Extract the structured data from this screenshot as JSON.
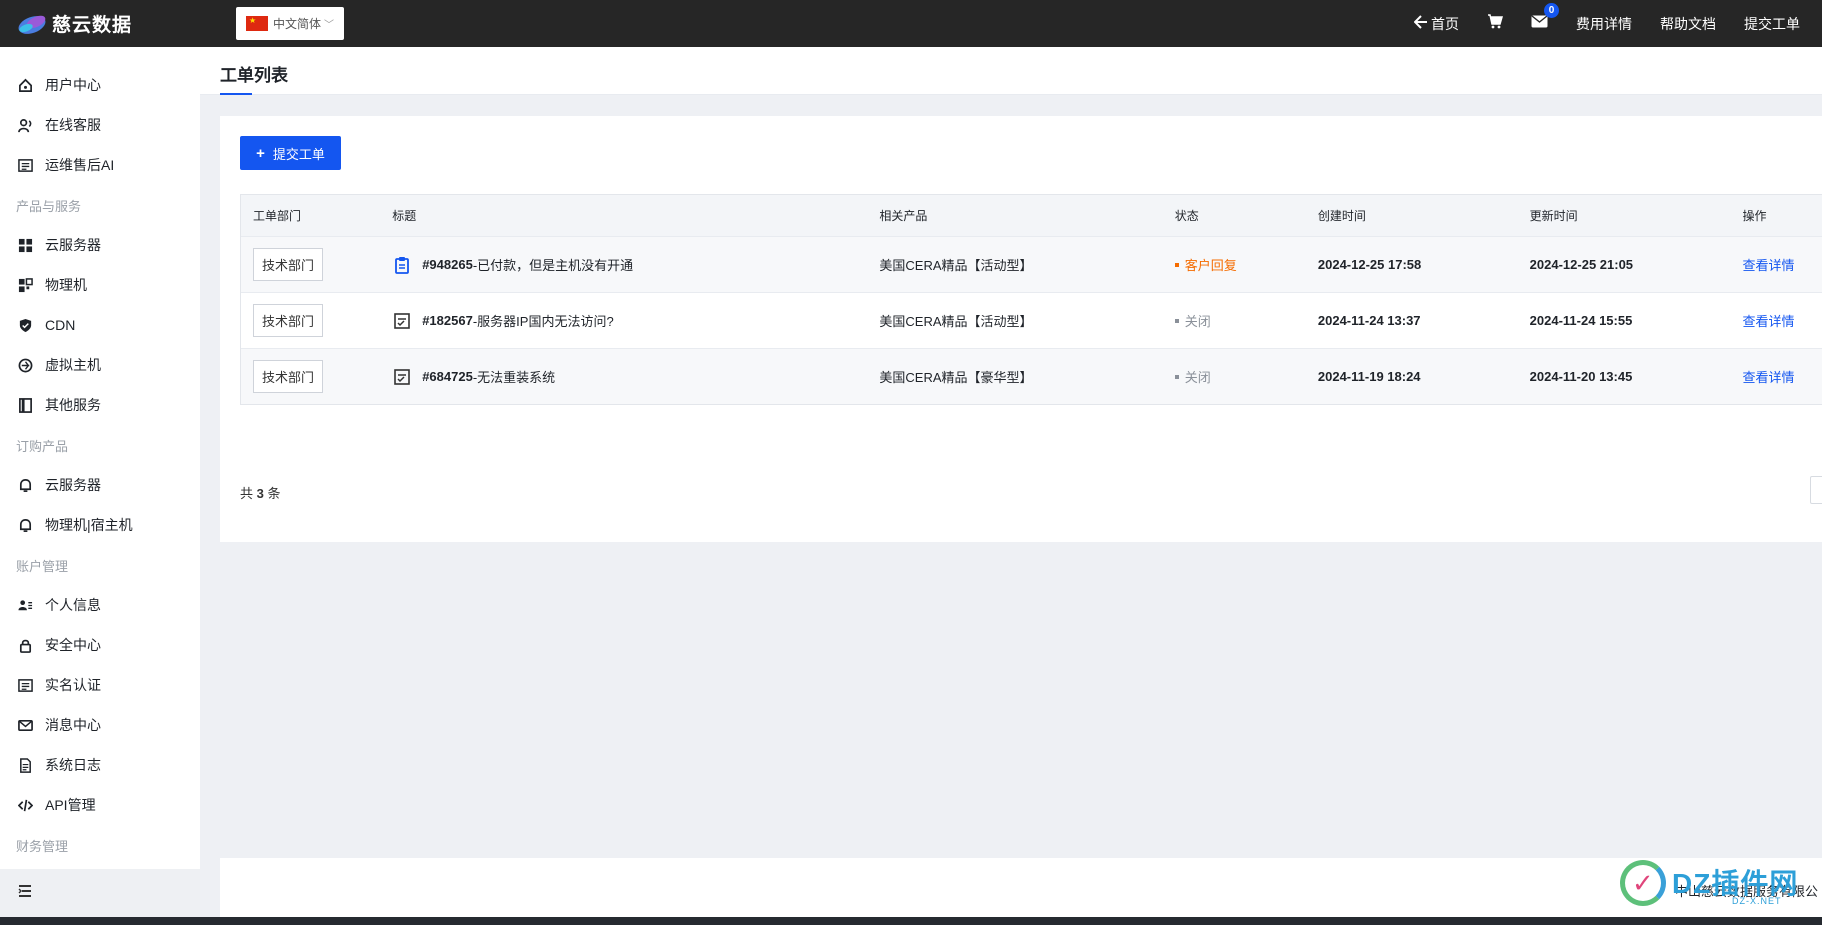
{
  "topbar": {
    "brand": "慈云数据",
    "language": "中文简体",
    "nav": {
      "home": "首页",
      "cart_icon": "cart-icon",
      "mail_icon": "mail-icon",
      "mail_badge": "0",
      "billing": "费用详情",
      "help": "帮助文档",
      "submit_ticket": "提交工单"
    }
  },
  "sidebar": {
    "items": [
      {
        "label": "用户中心",
        "icon": "home-icon"
      },
      {
        "label": "在线客服",
        "icon": "support-icon"
      },
      {
        "label": "运维售后AI",
        "icon": "ai-icon"
      }
    ],
    "group1": "产品与服务",
    "products": [
      {
        "label": "云服务器",
        "icon": "grid-icon"
      },
      {
        "label": "物理机",
        "icon": "server-icon"
      },
      {
        "label": "CDN",
        "icon": "shield-icon"
      },
      {
        "label": "虚拟主机",
        "icon": "host-icon"
      },
      {
        "label": "其他服务",
        "icon": "book-icon"
      }
    ],
    "group2": "订购产品",
    "orders": [
      {
        "label": "云服务器",
        "icon": "bell-icon"
      },
      {
        "label": "物理机|宿主机",
        "icon": "bell-icon"
      }
    ],
    "group3": "账户管理",
    "account": [
      {
        "label": "个人信息",
        "icon": "profile-icon"
      },
      {
        "label": "安全中心",
        "icon": "lock-icon"
      },
      {
        "label": "实名认证",
        "icon": "id-card-icon"
      },
      {
        "label": "消息中心",
        "icon": "mail-icon"
      },
      {
        "label": "系统日志",
        "icon": "document-icon"
      },
      {
        "label": "API管理",
        "icon": "code-icon"
      }
    ],
    "group4": "财务管理",
    "collapse_icon": "menu-collapse-icon"
  },
  "page": {
    "title": "工单列表",
    "submit_button": "提交工单"
  },
  "table": {
    "headers": [
      "工单部门",
      "标题",
      "相关产品",
      "状态",
      "创建时间",
      "更新时间",
      "操作"
    ],
    "rows": [
      {
        "dept": "技术部门",
        "id": "#948265",
        "title": "-已付款，但是主机没有开通",
        "product": "美国CERA精品【活动型】",
        "status": "客户回复",
        "status_color": "#f56c00",
        "created": "2024-12-25 17:58",
        "updated": "2024-12-25 21:05",
        "action": "查看详情",
        "icon": "clipboard-icon"
      },
      {
        "dept": "技术部门",
        "id": "#182567",
        "title": "-服务器IP国内无法访问?",
        "product": "美国CERA精品【活动型】",
        "status": "关闭",
        "status_color": "#8a9099",
        "created": "2024-11-24 13:37",
        "updated": "2024-11-24 15:55",
        "action": "查看详情",
        "icon": "checklist-icon"
      },
      {
        "dept": "技术部门",
        "id": "#684725",
        "title": "-无法重装系统",
        "product": "美国CERA精品【豪华型】",
        "status": "关闭",
        "status_color": "#8a9099",
        "created": "2024-11-19 18:24",
        "updated": "2024-11-20 13:45",
        "action": "查看详情",
        "icon": "checklist-icon"
      }
    ],
    "total_prefix": "共",
    "total_count": "3",
    "total_suffix": "条"
  },
  "footer": {
    "company": "中山慈云数据服务有限公"
  },
  "watermark": {
    "text": "DZ插件网",
    "sub": "DZ-X.NET"
  },
  "colors": {
    "accent": "#1456f0",
    "topbar_bg": "#262626",
    "status_reply": "#f56c00",
    "status_closed": "#8a9099"
  }
}
